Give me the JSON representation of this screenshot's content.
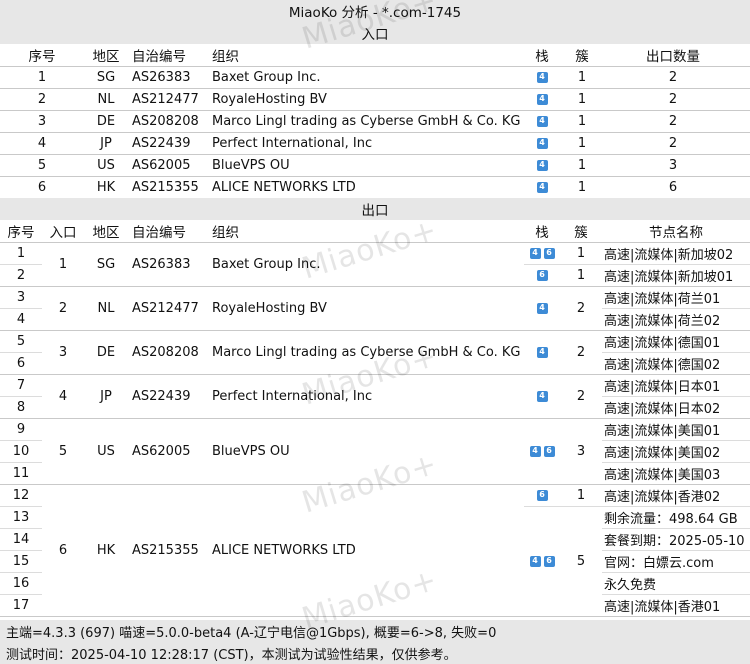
{
  "title": "MiaoKo 分析 - *.com-1745",
  "watermark": "MiaoKo+",
  "inbound": {
    "section_title": "入口",
    "headers": {
      "no": "序号",
      "region": "地区",
      "asn": "自治编号",
      "org": "组织",
      "stack": "栈",
      "cluster": "簇",
      "count": "出口数量"
    },
    "rows": [
      {
        "no": "1",
        "region": "SG",
        "asn": "AS26383",
        "org": "Baxet Group Inc.",
        "stack": [
          "4"
        ],
        "cluster": "1",
        "count": "2"
      },
      {
        "no": "2",
        "region": "NL",
        "asn": "AS212477",
        "org": "RoyaleHosting BV",
        "stack": [
          "4"
        ],
        "cluster": "1",
        "count": "2"
      },
      {
        "no": "3",
        "region": "DE",
        "asn": "AS208208",
        "org": "Marco Lingl trading as Cyberse GmbH & Co. KG",
        "stack": [
          "4"
        ],
        "cluster": "1",
        "count": "2"
      },
      {
        "no": "4",
        "region": "JP",
        "asn": "AS22439",
        "org": "Perfect International, Inc",
        "stack": [
          "4"
        ],
        "cluster": "1",
        "count": "2"
      },
      {
        "no": "5",
        "region": "US",
        "asn": "AS62005",
        "org": "BlueVPS OU",
        "stack": [
          "4"
        ],
        "cluster": "1",
        "count": "3"
      },
      {
        "no": "6",
        "region": "HK",
        "asn": "AS215355",
        "org": "ALICE NETWORKS LTD",
        "stack": [
          "4"
        ],
        "cluster": "1",
        "count": "6"
      }
    ]
  },
  "outbound": {
    "section_title": "出口",
    "headers": {
      "no": "序号",
      "entry": "入口",
      "region": "地区",
      "asn": "自治编号",
      "org": "组织",
      "stack": "栈",
      "cluster": "簇",
      "node": "节点名称"
    },
    "groups": [
      {
        "entry": "1",
        "region": "SG",
        "asn": "AS26383",
        "org": "Baxet Group Inc.",
        "clusters": [
          {
            "stack": [
              "4",
              "6"
            ],
            "value": "1",
            "span": 1
          },
          {
            "stack": [
              "6"
            ],
            "value": "1",
            "span": 1
          }
        ],
        "rows": [
          {
            "no": "1",
            "node": "高速|流媒体|新加坡02"
          },
          {
            "no": "2",
            "node": "高速|流媒体|新加坡01"
          }
        ]
      },
      {
        "entry": "2",
        "region": "NL",
        "asn": "AS212477",
        "org": "RoyaleHosting BV",
        "clusters": [
          {
            "stack": [
              "4"
            ],
            "value": "2",
            "span": 2
          }
        ],
        "rows": [
          {
            "no": "3",
            "node": "高速|流媒体|荷兰01"
          },
          {
            "no": "4",
            "node": "高速|流媒体|荷兰02"
          }
        ]
      },
      {
        "entry": "3",
        "region": "DE",
        "asn": "AS208208",
        "org": "Marco Lingl trading as Cyberse GmbH & Co. KG",
        "clusters": [
          {
            "stack": [
              "4"
            ],
            "value": "2",
            "span": 2
          }
        ],
        "rows": [
          {
            "no": "5",
            "node": "高速|流媒体|德国01"
          },
          {
            "no": "6",
            "node": "高速|流媒体|德国02"
          }
        ]
      },
      {
        "entry": "4",
        "region": "JP",
        "asn": "AS22439",
        "org": "Perfect International, Inc",
        "clusters": [
          {
            "stack": [
              "4"
            ],
            "value": "2",
            "span": 2
          }
        ],
        "rows": [
          {
            "no": "7",
            "node": "高速|流媒体|日本01"
          },
          {
            "no": "8",
            "node": "高速|流媒体|日本02"
          }
        ]
      },
      {
        "entry": "5",
        "region": "US",
        "asn": "AS62005",
        "org": "BlueVPS OU",
        "clusters": [
          {
            "stack": [
              "4",
              "6"
            ],
            "value": "3",
            "span": 3
          }
        ],
        "rows": [
          {
            "no": "9",
            "node": "高速|流媒体|美国01"
          },
          {
            "no": "10",
            "node": "高速|流媒体|美国02"
          },
          {
            "no": "11",
            "node": "高速|流媒体|美国03"
          }
        ]
      },
      {
        "entry": "6",
        "region": "HK",
        "asn": "AS215355",
        "org": "ALICE NETWORKS LTD",
        "clusters": [
          {
            "stack": [
              "6"
            ],
            "value": "1",
            "span": 1
          },
          {
            "stack": [
              "4",
              "6"
            ],
            "value": "5",
            "span": 5
          }
        ],
        "rows": [
          {
            "no": "12",
            "node": "高速|流媒体|香港02"
          },
          {
            "no": "13",
            "node": "剩余流量：498.64 GB"
          },
          {
            "no": "14",
            "node": "套餐到期：2025-05-10"
          },
          {
            "no": "15",
            "node": "官网：白嫖云.com"
          },
          {
            "no": "16",
            "node": "永久免费"
          },
          {
            "no": "17",
            "node": "高速|流媒体|香港01"
          }
        ]
      }
    ]
  },
  "footer": {
    "line1": "主端=4.3.3 (697) 喵速=5.0.0-beta4 (A-辽宁电信@1Gbps), 概要=6->8, 失败=0",
    "line2": "测试时间：2025-04-10 12:28:17 (CST)，本测试为试验性结果，仅供参考。"
  }
}
